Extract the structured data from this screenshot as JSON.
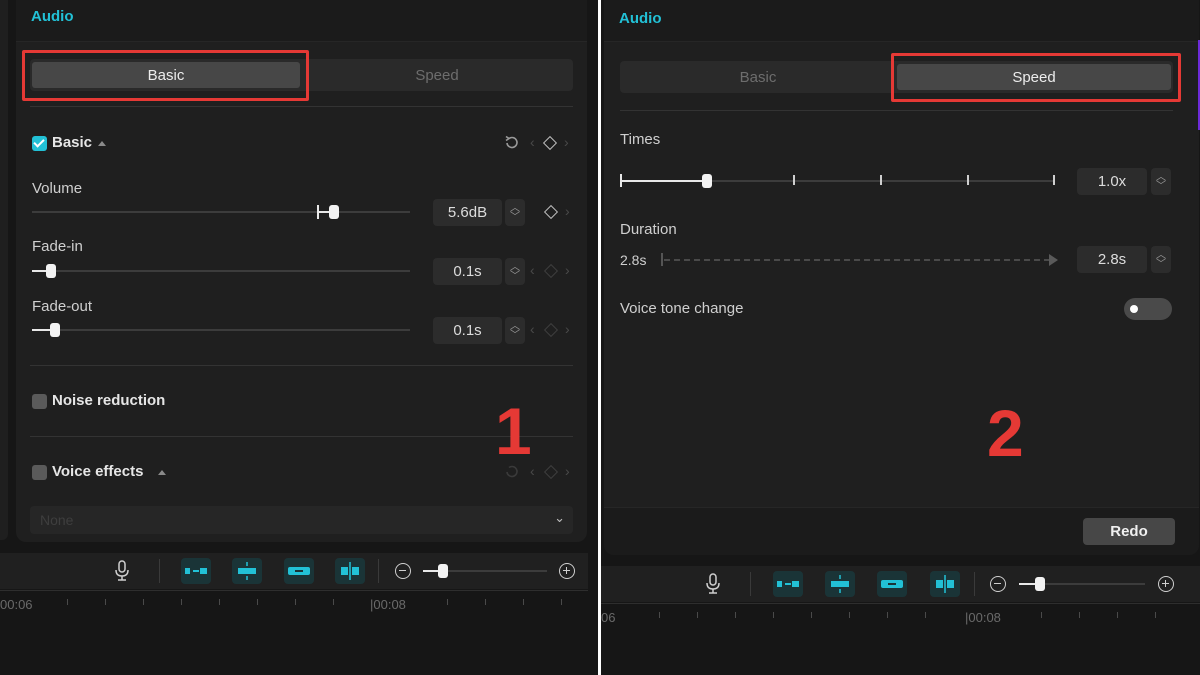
{
  "left": {
    "panel_title": "Audio",
    "tabs": [
      "Basic",
      "Speed"
    ],
    "active_tab": "Basic",
    "basic_section": {
      "title": "Basic",
      "enabled": true,
      "sliders": [
        {
          "label": "Volume",
          "value": "5.6dB",
          "level": 0.8
        },
        {
          "label": "Fade-in",
          "value": "0.1s",
          "level": 0.05
        },
        {
          "label": "Fade-out",
          "value": "0.1s",
          "level": 0.06
        }
      ]
    },
    "noise_reduction": {
      "label": "Noise reduction",
      "enabled": false
    },
    "voice_effects": {
      "label": "Voice effects",
      "enabled": false,
      "select_value": "None"
    },
    "timeline": {
      "times": [
        "00:06",
        "|00:08"
      ]
    },
    "callout_number": "1"
  },
  "right": {
    "panel_title": "Audio",
    "tabs": [
      "Basic",
      "Speed"
    ],
    "active_tab": "Speed",
    "times": {
      "label": "Times",
      "value": "1.0x",
      "level": 0.2
    },
    "duration": {
      "label": "Duration",
      "start_value": "2.8s",
      "value": "2.8s"
    },
    "voice_tone": {
      "label": "Voice tone change",
      "enabled": false
    },
    "redo_label": "Redo",
    "timeline": {
      "times": [
        "06",
        "|00:08"
      ]
    },
    "callout_number": "2"
  },
  "colors": {
    "accent": "#22c1d6",
    "highlight": "#e53935",
    "panel_bg": "#1f1f1f"
  },
  "icons": [
    "refresh-icon",
    "keyframe-diamond-icon",
    "microphone-icon",
    "split-icon",
    "zoom-out-icon",
    "zoom-in-icon",
    "chevron-down-icon"
  ]
}
